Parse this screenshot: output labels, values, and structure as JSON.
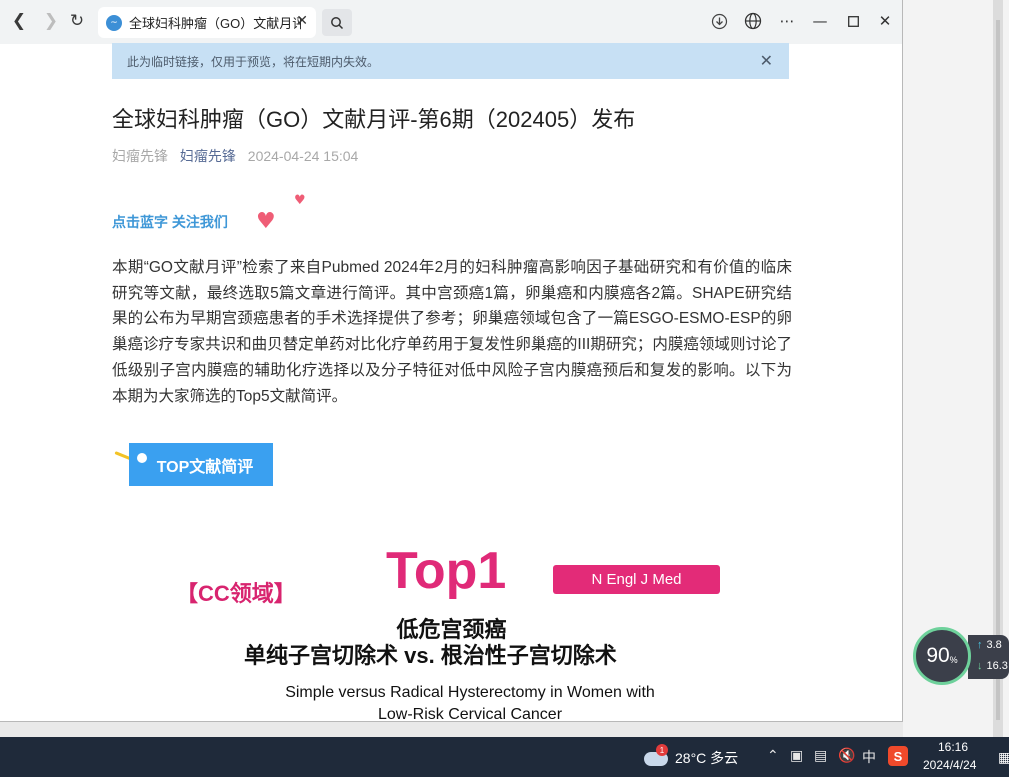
{
  "browser": {
    "tab_title": "全球妇科肿瘤（GO）文献月评",
    "nav": {
      "back_icon": "back-arrow-icon",
      "forward_icon": "forward-arrow-icon",
      "refresh_icon": "refresh-icon"
    }
  },
  "notice": {
    "text": "此为临时链接，仅用于预览，将在短期内失效。"
  },
  "article": {
    "title": "全球妇科肿瘤（GO）文献月评-第6期（202405）发布",
    "author": "妇瘤先锋",
    "account": "妇瘤先锋",
    "date": "2024-04-24 15:04",
    "follow_text": "点击蓝字 关注我们",
    "paragraph": "本期“GO文献月评”检索了来自Pubmed 2024年2月的妇科肿瘤高影响因子基础研究和有价值的临床研究等文献，最终选取5篇文章进行简评。其中宫颈癌1篇，卵巢癌和内膜癌各2篇。SHAPE研究结果的公布为早期宫颈癌患者的手术选择提供了参考；卵巢癌领域包含了一篇ESGO-ESMO-ESP的卵巢癌诊疗专家共识和曲贝替定单药对比化疗单药用于复发性卵巢癌的III期研究；内膜癌领域则讨论了低级别子宫内膜癌的辅助化疗选择以及分子特征对低中风险子宫内膜癌预后和复发的影响。以下为本期为大家筛选的Top5文献简评。",
    "section_banner": "TOP文献简评",
    "top_label": "Top1",
    "field_label": "【CC领域】",
    "journal": "N Engl J Med",
    "cn_title_line1": "低危宫颈癌",
    "cn_title_line2": "单纯子宫切除术 vs. 根治性子宫切除术",
    "en_title_line1": "Simple versus Radical Hysterectomy in Women with",
    "en_title_line2": "Low-Risk Cervical Cancer"
  },
  "speed_widget": {
    "percent": "90",
    "percent_unit": "%",
    "upload": "3.8",
    "download": "16.3"
  },
  "taskbar": {
    "weather_badge": "1",
    "weather": "28°C  多云",
    "ime": "中",
    "sogou": "S",
    "time": "16:16",
    "date": "2024/4/24"
  }
}
